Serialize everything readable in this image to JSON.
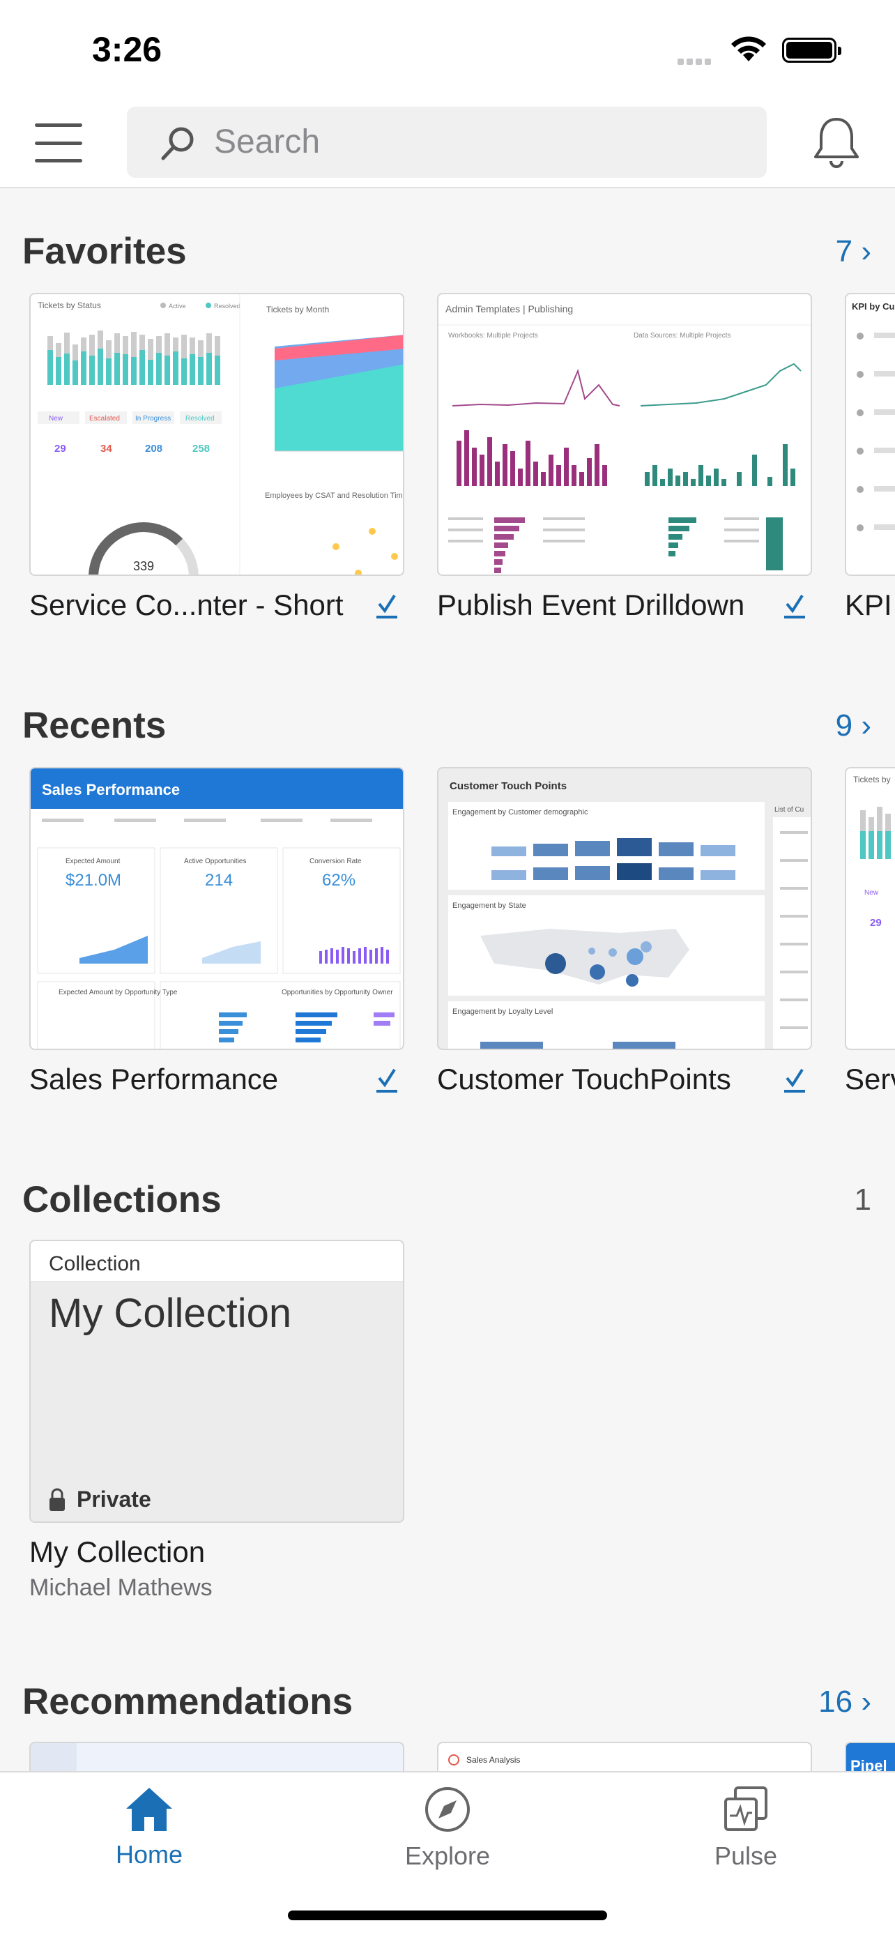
{
  "status_bar": {
    "time": "3:26"
  },
  "search": {
    "placeholder": "Search",
    "value": ""
  },
  "sections": {
    "favorites": {
      "title": "Favorites",
      "link": "7 ›",
      "items": [
        {
          "label": "Service Co...nter - Short"
        },
        {
          "label": "Publish Event Drilldown"
        },
        {
          "label": "KPI by Customer"
        }
      ]
    },
    "recents": {
      "title": "Recents",
      "link": "9 ›",
      "items": [
        {
          "label": "Sales Performance"
        },
        {
          "label": "Customer TouchPoints"
        },
        {
          "label": "Service Center"
        }
      ]
    },
    "collections": {
      "title": "Collections",
      "count": "1",
      "items": [
        {
          "badge": "Collection",
          "name": "My Collection",
          "privacy": "Private",
          "label": "My Collection",
          "owner": "Michael Mathews"
        }
      ]
    },
    "recommendations": {
      "title": "Recommendations",
      "link": "16 ›",
      "items": [
        {
          "preview_text": "Sales Analysis"
        },
        {
          "preview_text": "Pipel"
        }
      ]
    }
  },
  "thumbnails": {
    "service_center": {
      "heading": "Tickets by Status",
      "heading2": "Tickets by Month",
      "heading3": "Employees by CSAT and Resolution Time",
      "legend1": "Active",
      "legend2": "Resolved",
      "statuses": [
        "New",
        "Escalated",
        "In Progress",
        "Resolved"
      ],
      "counts": [
        "29",
        "34",
        "208",
        "258"
      ],
      "gauge": "339"
    },
    "publish_event": {
      "heading": "Admin Templates | Publishing",
      "panel1": "Workbooks: Multiple Projects",
      "panel2": "Data Sources: Multiple Projects"
    },
    "sales_performance": {
      "title": "Sales Performance",
      "kpi1_label": "Expected Amount",
      "kpi1": "$21.0M",
      "kpi2_label": "Active Opportunities",
      "kpi2": "214",
      "kpi3_label": "Conversion Rate",
      "kpi3": "62%",
      "section": "Opportunities by Opportunity Owner",
      "section2": "Expected Amount by Opportunity Type"
    },
    "customer_touch": {
      "title": "Customer Touch Points",
      "panel1": "Engagement by Customer demographic",
      "panel2": "Engagement by State",
      "panel3": "Engagement by Loyalty Level",
      "side": "List of Cu"
    }
  },
  "tabs": [
    {
      "label": "Home",
      "active": true
    },
    {
      "label": "Explore",
      "active": false
    },
    {
      "label": "Pulse",
      "active": false
    }
  ],
  "colors": {
    "accent": "#1a6fb5",
    "tableau_blue": "#1f77d6",
    "teal": "#4fc7c2"
  }
}
